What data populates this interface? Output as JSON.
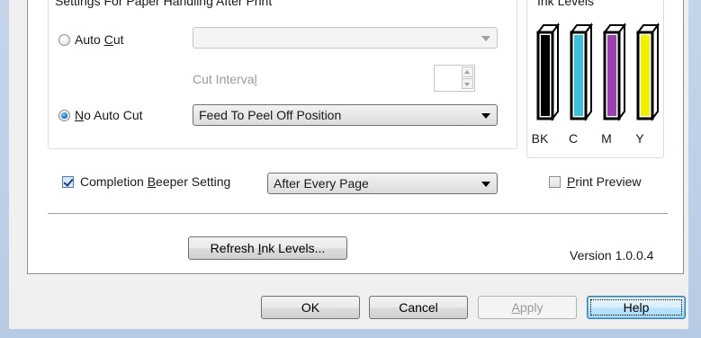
{
  "paper_handling": {
    "group_title": "Settings For Paper Handling After Print",
    "auto_cut": {
      "label_pre": "Auto ",
      "label_key": "C",
      "label_post": "ut",
      "checked": false,
      "select_value": ""
    },
    "cut_interval": {
      "label_pre": "Cut Interva",
      "label_key": "l",
      "label_post": "",
      "value": ""
    },
    "no_auto_cut": {
      "label_pre": "",
      "label_key": "N",
      "label_post": "o Auto Cut",
      "checked": true,
      "select_value": "Feed To Peel Off Position"
    }
  },
  "ink_levels": {
    "group_title": "Ink Levels",
    "cartridges": [
      {
        "label": "BK",
        "color": "#000000",
        "level": 1.0
      },
      {
        "label": "C",
        "color": "#40c0d8",
        "level": 1.0
      },
      {
        "label": "M",
        "color": "#a040b0",
        "level": 1.0
      },
      {
        "label": "Y",
        "color": "#f0f000",
        "level": 1.0
      }
    ]
  },
  "beeper": {
    "label_pre": "Completion ",
    "label_key": "B",
    "label_post": "eeper Setting",
    "checked": true,
    "select_value": "After Every Page"
  },
  "print_preview": {
    "label_pre": "",
    "label_key": "P",
    "label_post": "rint Preview",
    "checked": false
  },
  "refresh_button": {
    "label_pre": "Refresh ",
    "label_key": "I",
    "label_post": "nk Levels..."
  },
  "version": "Version 1.0.0.4",
  "footer": {
    "ok": "OK",
    "cancel": "Cancel",
    "apply_pre": "",
    "apply_key": "A",
    "apply_post": "pply",
    "help": "Help"
  }
}
